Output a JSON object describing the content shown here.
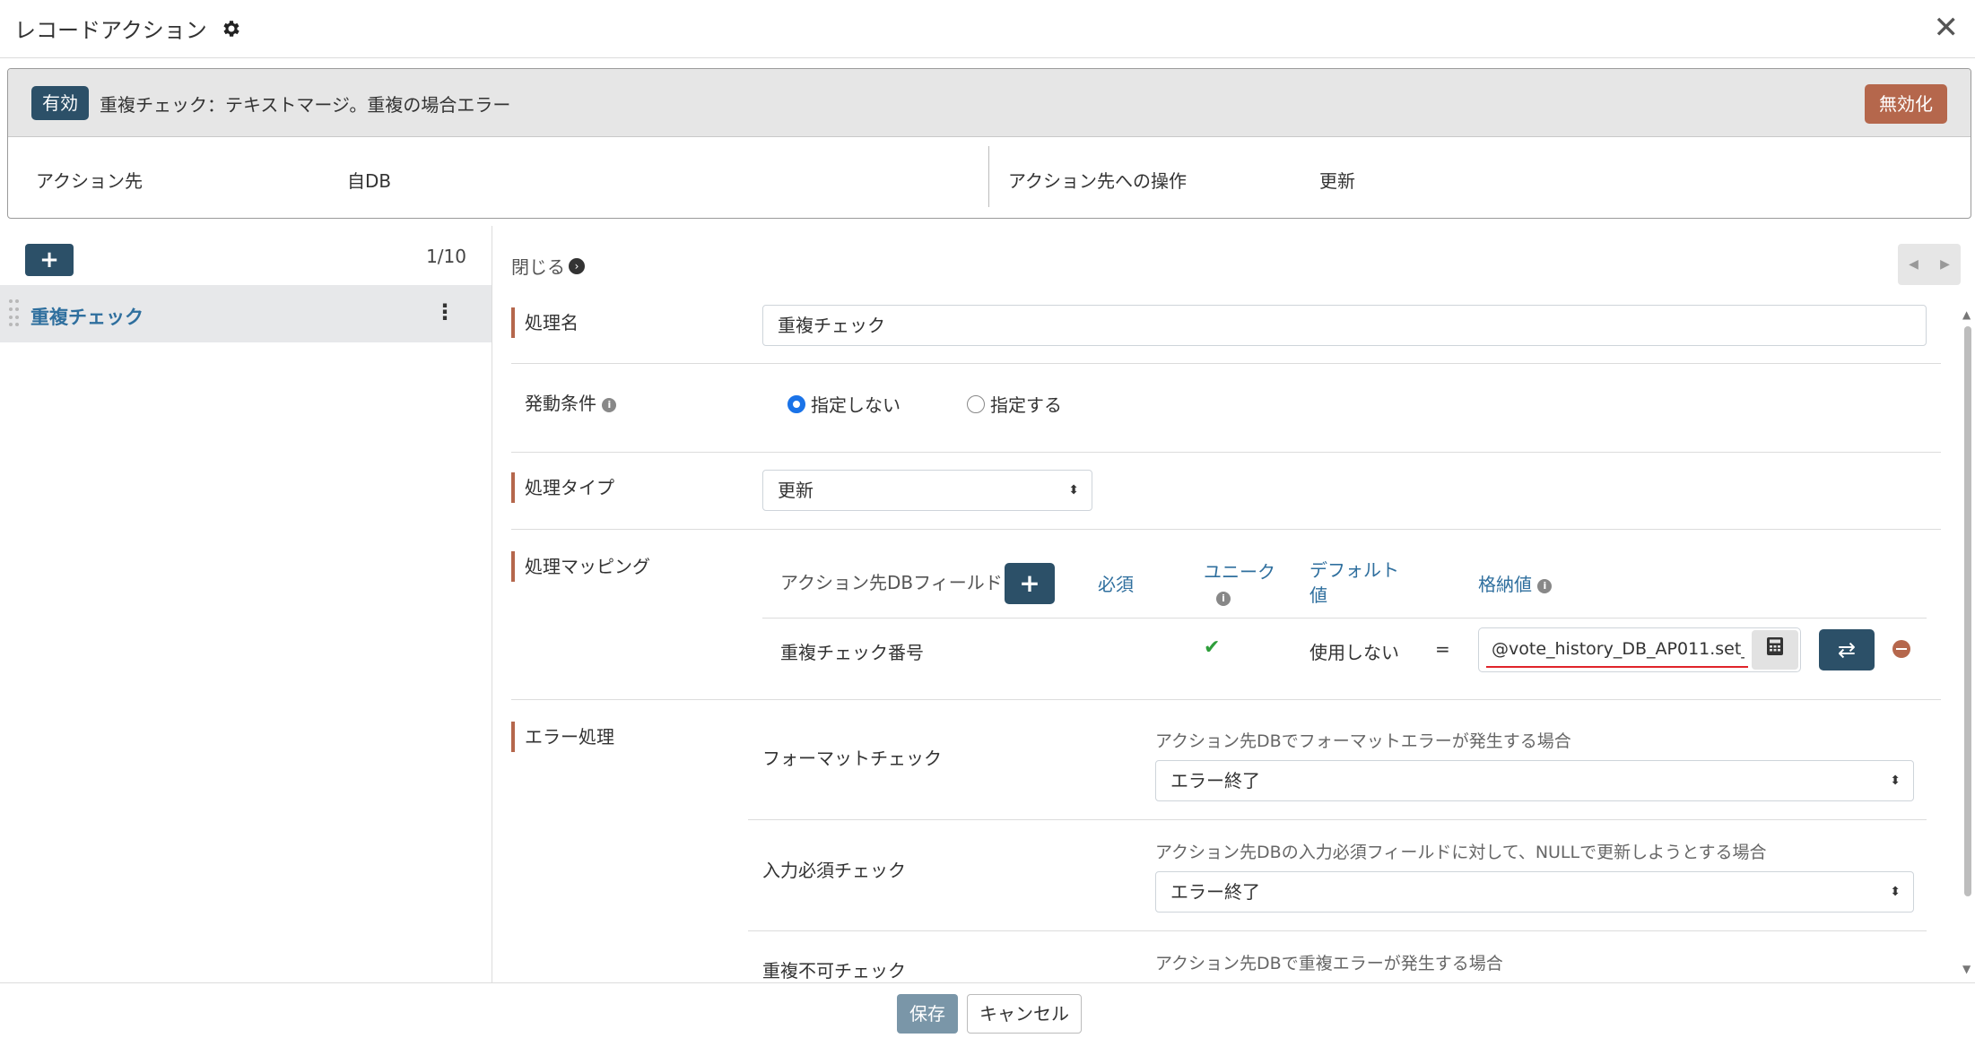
{
  "window": {
    "title": "レコードアクション"
  },
  "summary": {
    "status_badge": "有効",
    "description": "重複チェック：テキストマージ。重複の場合エラー",
    "disable_label": "無効化",
    "target_label": "アクション先",
    "target_value": "自DB",
    "operation_label": "アクション先への操作",
    "operation_value": "更新"
  },
  "sidebar": {
    "add_label": "+",
    "counter": "1/10",
    "items": [
      {
        "label": "重複チェック"
      }
    ]
  },
  "detail": {
    "close_label": "閉じる",
    "name": {
      "label": "処理名",
      "value": "重複チェック"
    },
    "trigger": {
      "label": "発動条件",
      "options": [
        "指定しない",
        "指定する"
      ],
      "selected": "指定しない"
    },
    "type": {
      "label": "処理タイプ",
      "value": "更新"
    },
    "mapping": {
      "label": "処理マッピング",
      "headers": {
        "field": "アクション先DBフィールド",
        "add": "+",
        "required": "必須",
        "unique": "ユニーク",
        "default_line1": "デフォルト",
        "default_line2": "値",
        "stored": "格納値"
      },
      "rows": [
        {
          "field": "重複チェック番号",
          "unique": true,
          "default": "使用しない",
          "op": "=",
          "stored": "@vote_history_DB_AP011.set_"
        }
      ]
    },
    "error": {
      "label": "エラー処理",
      "checks": [
        {
          "name": "フォーマットチェック",
          "desc": "アクション先DBでフォーマットエラーが発生する場合",
          "value": "エラー終了"
        },
        {
          "name": "入力必須チェック",
          "desc": "アクション先DBの入力必須フィールドに対して、NULLで更新しようとする場合",
          "value": "エラー終了"
        },
        {
          "name": "重複不可チェック",
          "desc": "アクション先DBで重複エラーが発生する場合"
        }
      ]
    }
  },
  "footer": {
    "save_label": "保存",
    "cancel_label": "キャンセル"
  },
  "colors": {
    "primary": "#2c5068",
    "danger": "#b5674c",
    "link": "#2f6f9e",
    "check": "#2e9e3a",
    "radio": "#1a73e8"
  }
}
